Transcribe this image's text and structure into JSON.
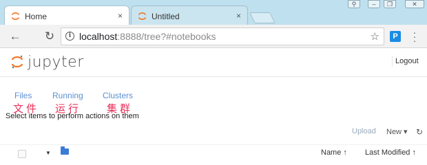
{
  "browser": {
    "tabs": [
      {
        "title": "Home",
        "close": "×"
      },
      {
        "title": "Untitled",
        "close": "×"
      }
    ],
    "address": {
      "host": "localhost",
      "rest": ":8888/tree?#notebooks"
    },
    "extension_label": "P"
  },
  "header": {
    "logo_text": "jupyter",
    "logout_label": "Logout"
  },
  "nav_tabs": [
    {
      "label": "Files",
      "annotation": "文件"
    },
    {
      "label": "Running",
      "annotation": "运行"
    },
    {
      "label": "Clusters",
      "annotation": "集群"
    }
  ],
  "hint": "Select items to perform actions on them",
  "toolbar": {
    "upload_label": "Upload",
    "new_label": "New ▾",
    "refresh_icon": "refresh-icon"
  },
  "list_header": {
    "name_label": "Name ↑",
    "modified_label": "Last Modified ↑"
  },
  "colors": {
    "accent_link": "#5b8fd1",
    "annotation": "#e8315a",
    "jupyter_orange": "#f37726",
    "tabstrip": "#bfe0ee"
  }
}
